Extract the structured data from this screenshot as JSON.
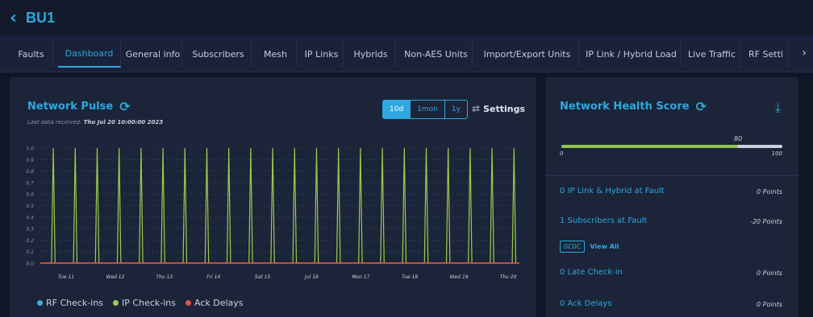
{
  "header": {
    "back_icon": "chevron-left-icon",
    "title": "BU1"
  },
  "tabs": [
    {
      "label": "Faults",
      "active": false
    },
    {
      "label": "Dashboard",
      "active": true
    },
    {
      "label": "General info",
      "active": false
    },
    {
      "label": "Subscribers",
      "active": false
    },
    {
      "label": "Mesh",
      "active": false
    },
    {
      "label": "IP Links",
      "active": false
    },
    {
      "label": "Hybrids",
      "active": false
    },
    {
      "label": "Non-AES Units",
      "active": false
    },
    {
      "label": "Import/Export Units",
      "active": false
    },
    {
      "label": "IP Link / Hybrid Load",
      "active": false
    },
    {
      "label": "Live Traffic",
      "active": false
    },
    {
      "label": "RF Setti",
      "active": false
    }
  ],
  "pulse": {
    "title": "Network Pulse",
    "last_received_label": "Last data received:",
    "last_received_value": "Thu Jul 20 10:00:00 2023",
    "ranges": [
      "10d",
      "1mon",
      "1y"
    ],
    "selected_range": "10d",
    "settings_label": "Settings"
  },
  "chart_data": {
    "type": "line",
    "title": "",
    "xlabel": "",
    "ylabel": "",
    "ylim": [
      0,
      1.0
    ],
    "yticks": [
      "0.0",
      "0.1",
      "0.2",
      "0.3",
      "0.4",
      "0.5",
      "0.6",
      "0.7",
      "0.8",
      "0.9",
      "1.0"
    ],
    "xticks": [
      "Tue 11",
      "Wed 12",
      "Thu 13",
      "Fri 14",
      "Sat 15",
      "Jul 16",
      "Mon 17",
      "Tue 18",
      "Wed 19",
      "Thu 20"
    ],
    "grid": true,
    "legend_placement": "bottom-left",
    "series": [
      {
        "name": "RF Check-ins",
        "color": "#3fa9e0",
        "values": []
      },
      {
        "name": "IP Check-ins",
        "color": "#9ccc4a",
        "spike_positions": [
          0.15,
          1.15,
          2.15,
          3.15,
          4.15,
          5.15,
          6.15,
          7.15,
          8.15,
          9.15,
          10.15,
          11.15,
          12.15,
          13.15,
          14.15,
          15.15,
          16.15,
          17.15,
          18.15,
          19.15,
          20.15,
          21.15
        ],
        "spike_value": 1.0
      },
      {
        "name": "Ack Delays",
        "color": "#e8504a",
        "values": [
          0
        ]
      }
    ]
  },
  "health": {
    "title": "Network Health Score",
    "download_icon": "download-icon",
    "score": 80,
    "min": "0",
    "max": "100",
    "rows": [
      {
        "label": "0 IP Link & Hybrid at Fault",
        "points": "0 Points"
      },
      {
        "label": "1 Subscribers at Fault",
        "points": "-20 Points"
      },
      {
        "label": "0 Late Check-in",
        "points": "0 Points"
      },
      {
        "label": "0 Ack Delays",
        "points": "0 Points"
      }
    ],
    "tag": "0C0C",
    "view_all": "View All"
  }
}
